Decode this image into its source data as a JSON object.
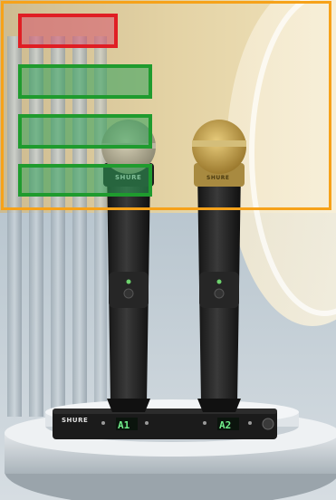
{
  "image": {
    "description_free": true,
    "receiver": {
      "brand_label": "SHURE",
      "channel_a": "A1",
      "channel_b": "A2"
    },
    "mic_left_brand": "SHURE",
    "mic_right_brand": "SHURE"
  },
  "overlay": {
    "frame_color": "#f6a21a",
    "boxes": [
      {
        "kind": "red",
        "color": "#e01e24"
      },
      {
        "kind": "green",
        "color": "#1f9b2e"
      },
      {
        "kind": "green",
        "color": "#1f9b2e"
      },
      {
        "kind": "green",
        "color": "#1f9b2e"
      }
    ]
  }
}
